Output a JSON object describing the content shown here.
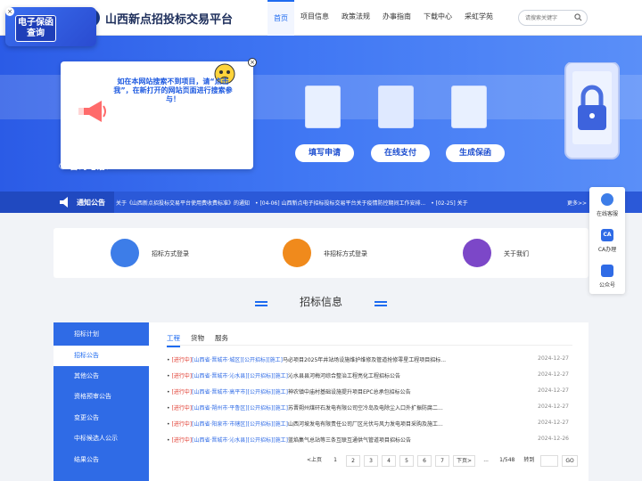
{
  "header": {
    "title": "山西新点招投标交易平台",
    "search_placeholder": "请搜索关键字"
  },
  "nav": [
    "首页",
    "项目信息",
    "政策法规",
    "办事指南",
    "下载中心",
    "采虹学苑"
  ],
  "badge": {
    "text": "电子保函\n查询"
  },
  "popup": {
    "message": "如在本网站搜索不到项目，请“点击我”，在新打开的网站页面进行搜索参与！"
  },
  "hotline": "咨询电话：13593190610",
  "steps": [
    "填写申请",
    "在线支付",
    "生成保函"
  ],
  "notice": {
    "label": "通知公告",
    "items": "关于《山西新点招投标交易平台使用费收费标准》的通知　• [04-06] 山西新点电子招标投标交易平台关于疫情防控期间工作安排...　• [02-25] 关于",
    "more": "更多>>"
  },
  "quick": [
    "招标方式登录",
    "非招标方式登录",
    "关于我们"
  ],
  "side": [
    "在线客服",
    "CA办理",
    "公众号"
  ],
  "side_ca_badge": "CA",
  "section_title": "招标信息",
  "sidebar": [
    "招标计划",
    "招标公告",
    "其他公告",
    "资格预审公告",
    "变更公告",
    "中标候选人公示",
    "结果公告"
  ],
  "tabs": [
    "工程",
    "货物",
    "服务"
  ],
  "rows": [
    {
      "tag": "[进行中]",
      "region": "[山西省·晋城市·城区][公开招标][施工]",
      "title": "马必项目2025年井站场设施维护维修及管道抢修零星工程项目招标...",
      "date": "2024-12-27"
    },
    {
      "tag": "[进行中]",
      "region": "[山西省·晋城市·沁水县][公开招标][施工]",
      "title": "沁水县县河梅河综合整治工程亮化工程招标公告",
      "date": "2024-12-27"
    },
    {
      "tag": "[进行中]",
      "region": "[山西省·晋城市·高平市][公开招标][施工]",
      "title": "神农镇中庙村基础设施提升项目EPC总承包招标公告",
      "date": "2024-12-27"
    },
    {
      "tag": "[进行中]",
      "region": "[山西省·朔州市·平鲁区][公开招标][施工]",
      "title": "苏晋朔州煤矸石发电有限公司空冷岛及电除尘入口外扩振防腐二...",
      "date": "2024-12-27"
    },
    {
      "tag": "[进行中]",
      "region": "[山西省·阳泉市·市辖区][公开招标][施工]",
      "title": "山西河坡发电有限责任公司厂区光伏与风力发电项目采购及施工...",
      "date": "2024-12-27"
    },
    {
      "tag": "[进行中]",
      "region": "[山西省·晋城市·沁水县][公开招标][施工]",
      "title": "蓝焰集气总站等三条互联互通供气管道项目招标公告",
      "date": "2024-12-26"
    }
  ],
  "pager": {
    "prev": "<上页",
    "pages": [
      "1",
      "2",
      "3",
      "4",
      "5",
      "6",
      "7"
    ],
    "next": "下页>",
    "ellipsis": "...",
    "total": "1/548",
    "goto": "转到",
    "go": "GO"
  }
}
